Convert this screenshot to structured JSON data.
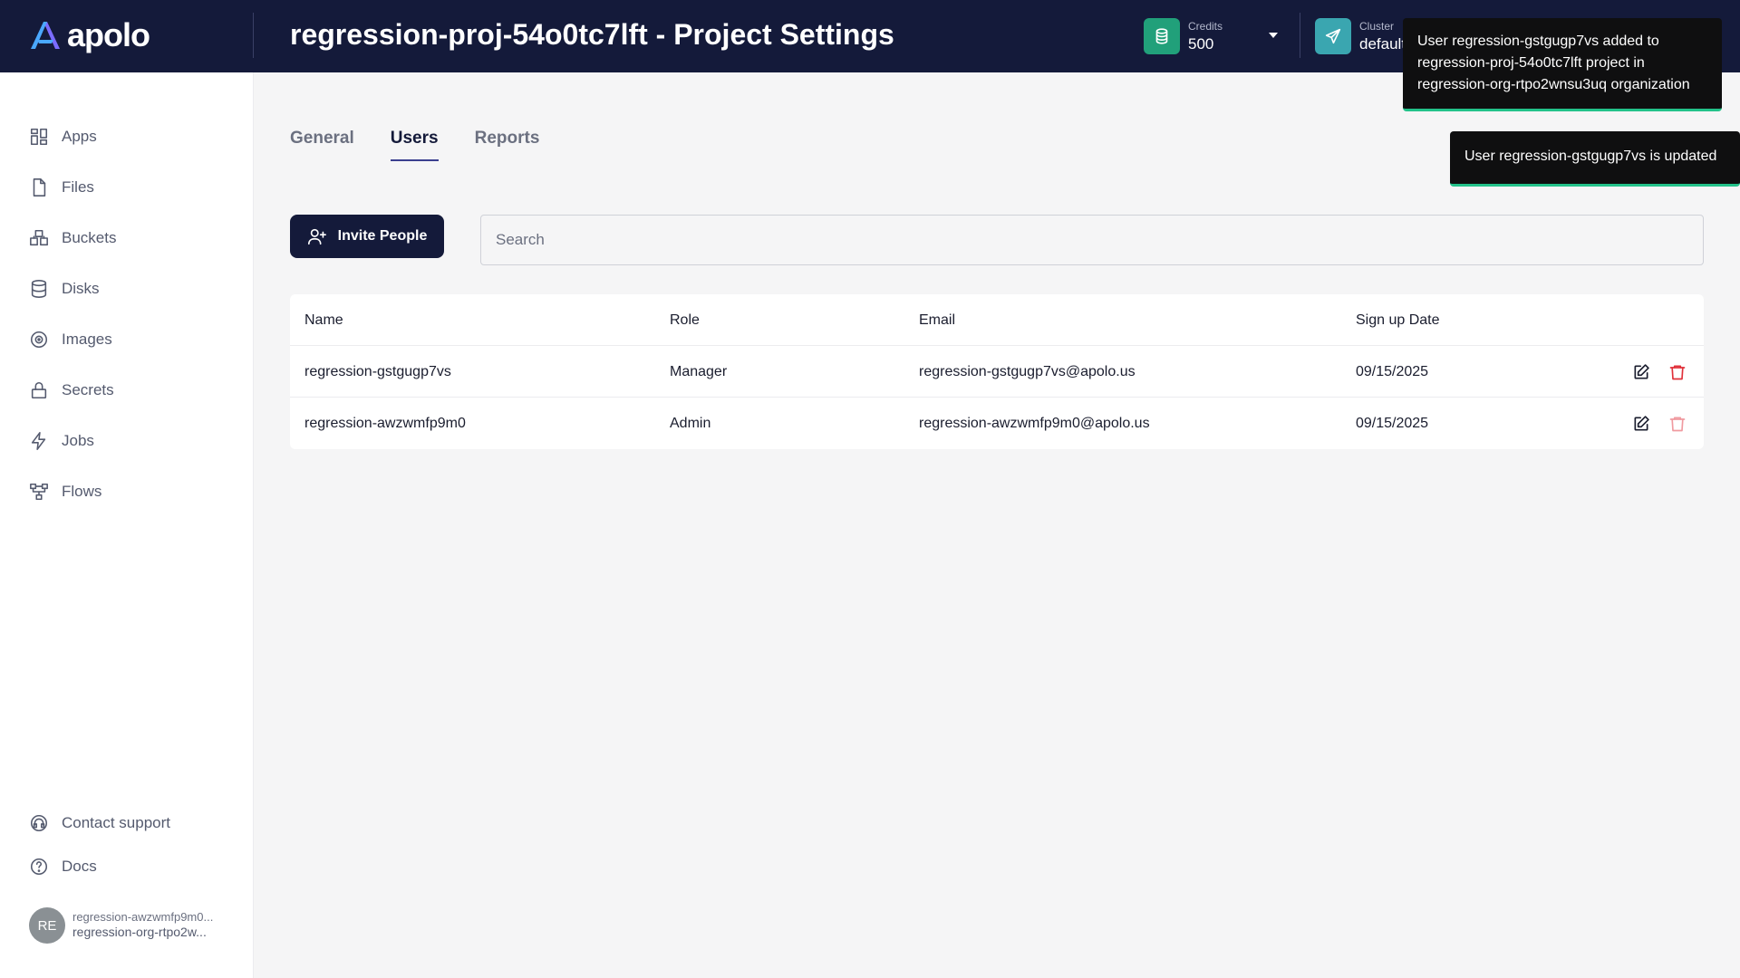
{
  "app": {
    "brand": "apolo"
  },
  "header": {
    "title": "regression-proj-54o0tc7lft - Project Settings",
    "credits": {
      "label": "Credits",
      "value": "500"
    },
    "cluster": {
      "label": "Cluster",
      "value": "default"
    }
  },
  "sidebar": {
    "items": [
      {
        "label": "Apps",
        "icon": "grid-icon"
      },
      {
        "label": "Files",
        "icon": "file-icon"
      },
      {
        "label": "Buckets",
        "icon": "bucket-icon"
      },
      {
        "label": "Disks",
        "icon": "database-icon"
      },
      {
        "label": "Images",
        "icon": "disc-icon"
      },
      {
        "label": "Secrets",
        "icon": "lock-icon"
      },
      {
        "label": "Jobs",
        "icon": "lightning-icon"
      },
      {
        "label": "Flows",
        "icon": "flow-icon"
      }
    ],
    "footer": {
      "support": "Contact support",
      "docs": "Docs"
    },
    "user": {
      "initials": "RE",
      "name": "regression-awzwmfp9m0...",
      "org": "regression-org-rtpo2w..."
    }
  },
  "tabs": [
    {
      "label": "General",
      "active": false
    },
    {
      "label": "Users",
      "active": true
    },
    {
      "label": "Reports",
      "active": false
    }
  ],
  "toolbar": {
    "invite_label": "Invite People",
    "search_placeholder": "Search"
  },
  "table": {
    "columns": [
      "Name",
      "Role",
      "Email",
      "Sign up Date"
    ],
    "rows": [
      {
        "name": "regression-gstgugp7vs",
        "role": "Manager",
        "email": "regression-gstgugp7vs@apolo.us",
        "date": "09/15/2025"
      },
      {
        "name": "regression-awzwmfp9m0",
        "role": "Admin",
        "email": "regression-awzwmfp9m0@apolo.us",
        "date": "09/15/2025"
      }
    ]
  },
  "toasts": [
    {
      "text": "User regression-gstgugp7vs added to regression-proj-54o0tc7lft project in regression-org-rtpo2wnsu3uq organization"
    },
    {
      "text": "User regression-gstgugp7vs is updated"
    }
  ],
  "colors": {
    "topbar": "#141a3a",
    "credits_tile": "#21a07a",
    "cluster_tile": "#3aa6b0",
    "delete_active": "#e0303a",
    "delete_disabled": "#f09aa0",
    "toast_accent": "#23c28a"
  }
}
